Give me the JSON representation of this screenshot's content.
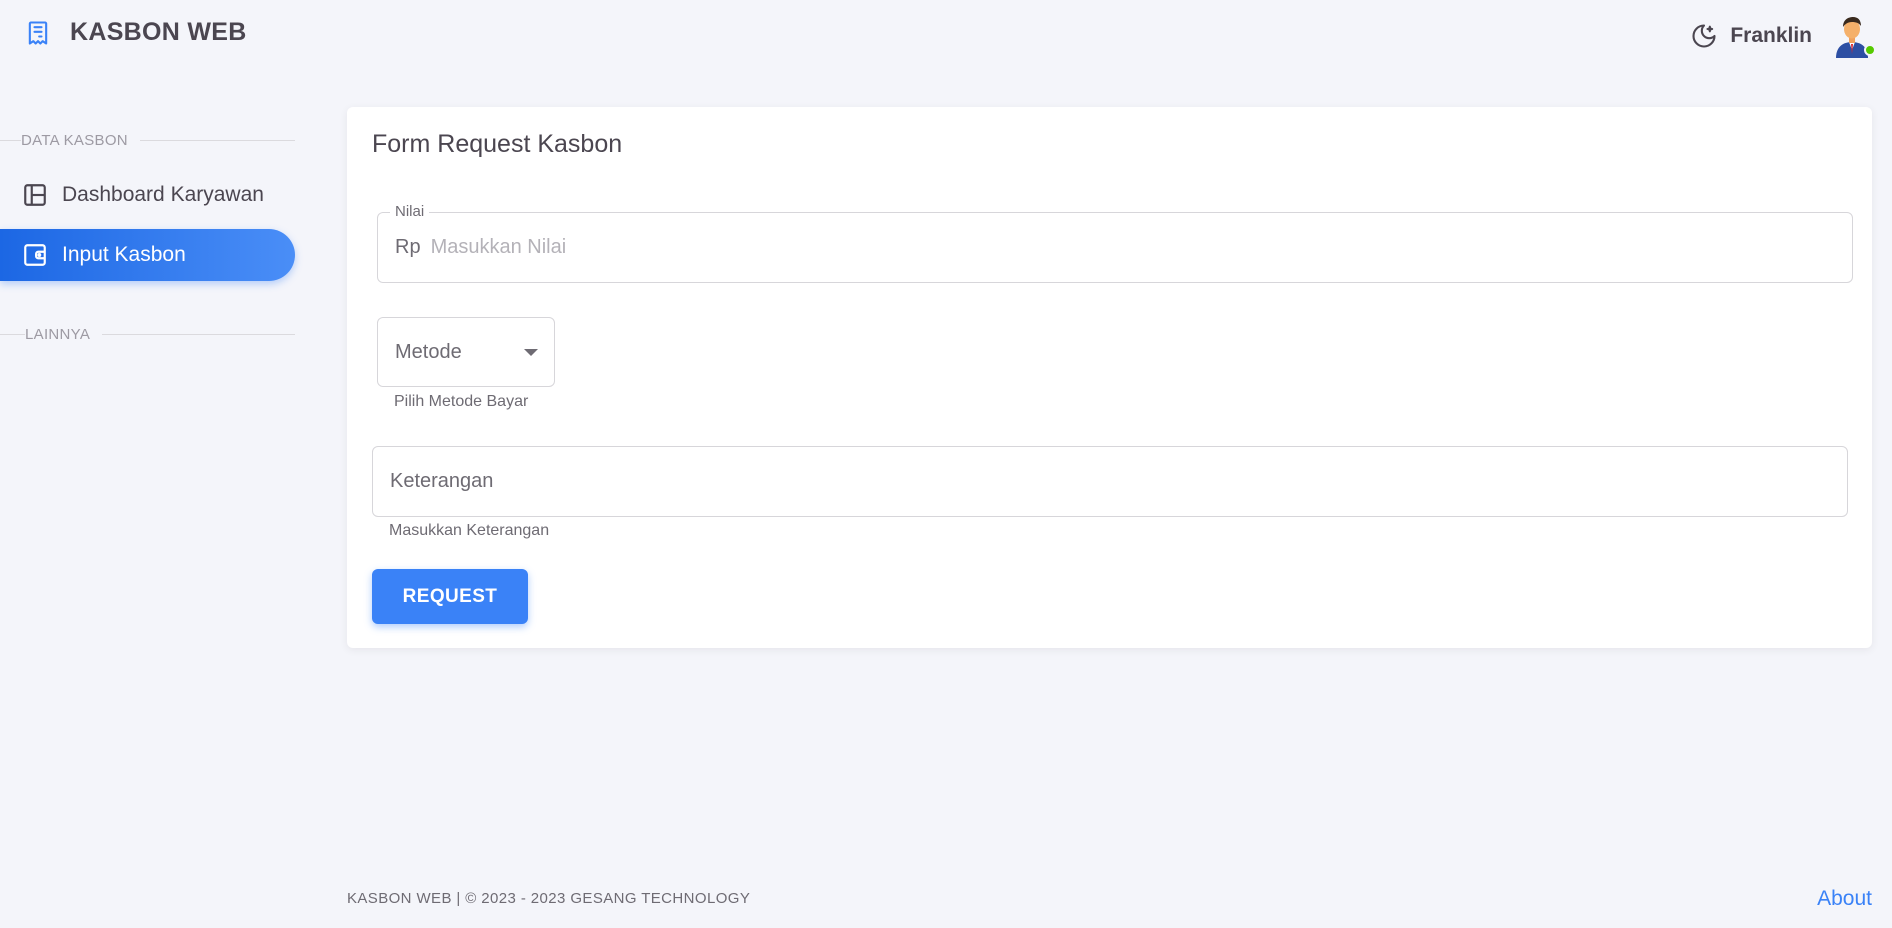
{
  "header": {
    "brand_title": "KASBON WEB",
    "user_name": "Franklin"
  },
  "sidebar": {
    "sections": [
      {
        "title": "DATA KASBON"
      },
      {
        "title": "LAINNYA"
      }
    ],
    "items": [
      {
        "label": "Dashboard Karyawan",
        "icon": "layout-icon",
        "active": false
      },
      {
        "label": "Input Kasbon",
        "icon": "wallet-icon",
        "active": true
      }
    ]
  },
  "form": {
    "title": "Form Request Kasbon",
    "nilai": {
      "label": "Nilai",
      "prefix": "Rp",
      "placeholder": "Masukkan Nilai",
      "value": ""
    },
    "metode": {
      "selected": "Metode",
      "helper": "Pilih Metode Bayar"
    },
    "keterangan": {
      "placeholder": "Keterangan",
      "helper": "Masukkan Keterangan",
      "value": ""
    },
    "submit_label": "REQUEST"
  },
  "footer": {
    "text": "KASBON WEB | © 2023 - 2023 GESANG TECHNOLOGY",
    "about": "About"
  },
  "colors": {
    "accent": "#3a82f7",
    "background": "#f4f5fa",
    "online": "#56ca00"
  }
}
